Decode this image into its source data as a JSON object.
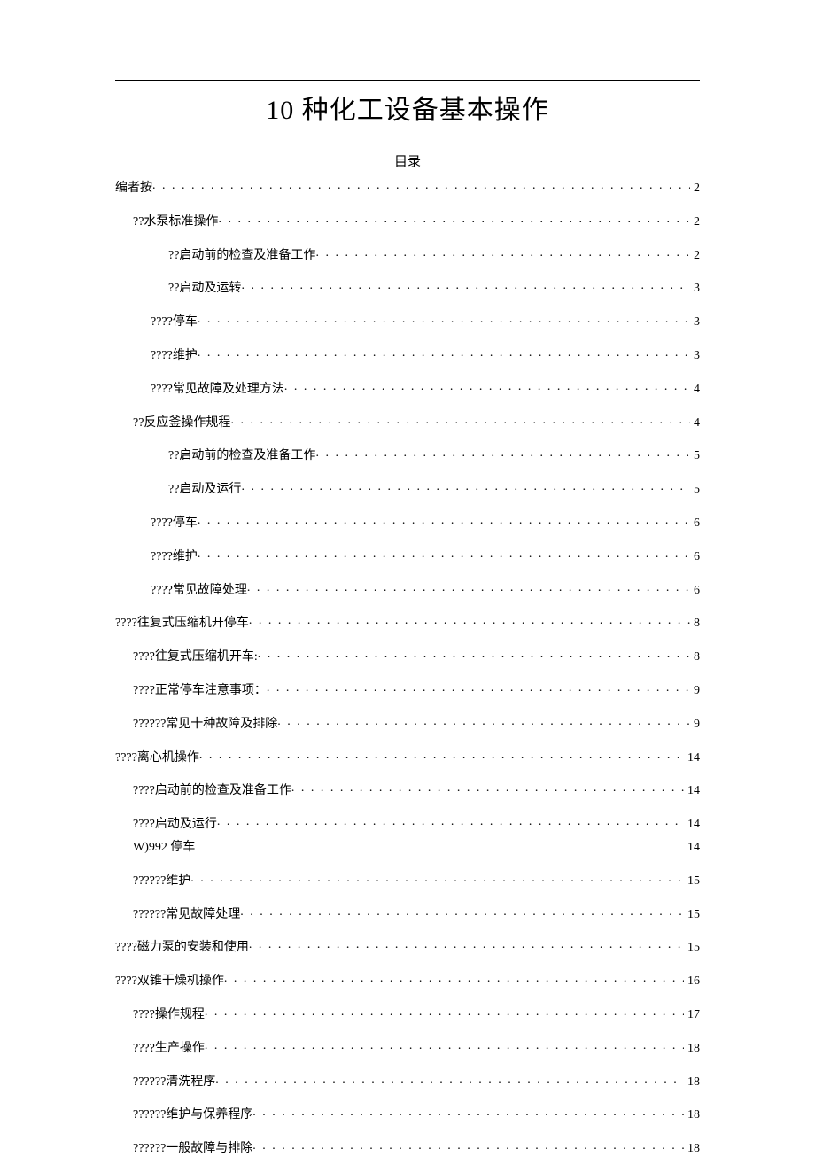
{
  "title": "10 种化工设备基本操作",
  "toc_heading": "目录",
  "toc": [
    {
      "label": "编者按",
      "page": "2",
      "indent": 0,
      "dots": true
    },
    {
      "label": "??水泵标准操作",
      "page": "2",
      "indent": 1,
      "dots": true
    },
    {
      "label": "??启动前的检查及准备工作",
      "page": "2",
      "indent": 3,
      "dots": true
    },
    {
      "label": "??启动及运转",
      "page": "3",
      "indent": 3,
      "dots": true
    },
    {
      "label": "????停车",
      "page": "3",
      "indent": 2,
      "dots": true
    },
    {
      "label": "????维护",
      "page": "3",
      "indent": 2,
      "dots": true
    },
    {
      "label": "????常见故障及处理方法",
      "page": "4",
      "indent": 2,
      "dots": true
    },
    {
      "label": "??反应釜操作规程",
      "page": "4",
      "indent": 1,
      "dots": true
    },
    {
      "label": "??启动前的检查及准备工作",
      "page": "5",
      "indent": 3,
      "dots": true
    },
    {
      "label": "??启动及运行",
      "page": "5",
      "indent": 3,
      "dots": true
    },
    {
      "label": "????停车",
      "page": "6",
      "indent": 2,
      "dots": true
    },
    {
      "label": "????维护",
      "page": "6",
      "indent": 2,
      "dots": true
    },
    {
      "label": "????常见故障处理",
      "page": "6",
      "indent": 2,
      "dots": true
    },
    {
      "label": "????往复式压缩机开停车",
      "page": "8",
      "indent": 0,
      "dots": true
    },
    {
      "label": "????往复式压缩机开车:",
      "page": "8",
      "indent": 1,
      "dots": true
    },
    {
      "label": "????正常停车注意事项：",
      "page": "9",
      "indent": 1,
      "dots": true
    },
    {
      "label": "??????常见十种故障及排除",
      "page": "9",
      "indent": 1,
      "dots": true
    },
    {
      "label": "????离心机操作",
      "page": "14",
      "indent": 0,
      "dots": true
    },
    {
      "label": "????启动前的检查及准备工作",
      "page": "14",
      "indent": 1,
      "dots": true
    },
    {
      "label": "????启动及运行",
      "page": "14",
      "indent": 1,
      "dots": true,
      "tight": true
    },
    {
      "label": "W)992 停车",
      "page": "14",
      "indent": 1,
      "dots": false
    },
    {
      "label": "??????维护",
      "page": "15",
      "indent": 1,
      "dots": true
    },
    {
      "label": "??????常见故障处理",
      "page": "15",
      "indent": 1,
      "dots": true
    },
    {
      "label": "????磁力泵的安装和使用",
      "page": "15",
      "indent": 0,
      "dots": true
    },
    {
      "label": "????双锥干燥机操作",
      "page": "16",
      "indent": 0,
      "dots": true
    },
    {
      "label": "????操作规程",
      "page": "17",
      "indent": 1,
      "dots": true
    },
    {
      "label": "????生产操作",
      "page": "18",
      "indent": 1,
      "dots": true
    },
    {
      "label": "??????清洗程序",
      "page": "18",
      "indent": 1,
      "dots": true
    },
    {
      "label": "??????维护与保养程序",
      "page": "18",
      "indent": 1,
      "dots": true
    },
    {
      "label": "??????一般故障与排除",
      "page": "18",
      "indent": 1,
      "dots": true
    }
  ]
}
